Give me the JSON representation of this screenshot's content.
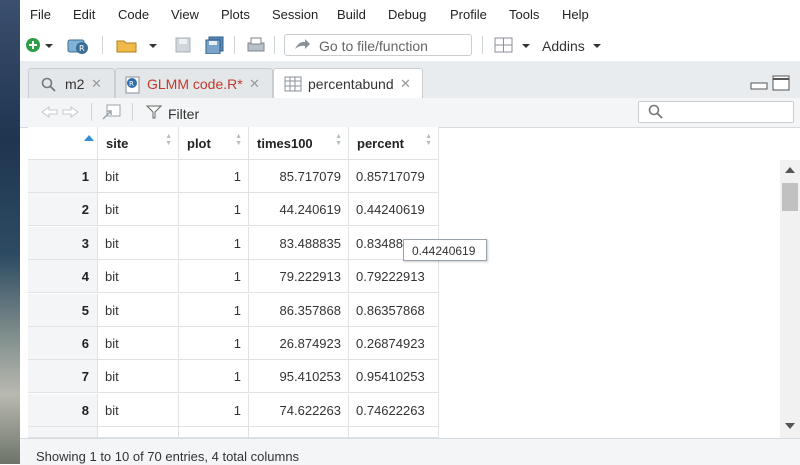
{
  "menu": [
    "File",
    "Edit",
    "Code",
    "View",
    "Plots",
    "Session",
    "Build",
    "Debug",
    "Profile",
    "Tools",
    "Help"
  ],
  "toolbar": {
    "goto_placeholder": "Go to file/function",
    "addins_label": "Addins"
  },
  "tabs": [
    {
      "label": "m2",
      "icon": "search-icon",
      "active": false
    },
    {
      "label": "GLMM code.R*",
      "icon": "r-script-icon",
      "active": false,
      "color": "#c0392b"
    },
    {
      "label": "percentabund",
      "icon": "table-icon",
      "active": true
    }
  ],
  "filter": {
    "label": "Filter"
  },
  "table": {
    "columns": [
      "site",
      "plot",
      "times100",
      "percent"
    ],
    "rows": [
      [
        "1",
        "bit",
        "1",
        "85.717079",
        "0.85717079"
      ],
      [
        "2",
        "bit",
        "1",
        "44.240619",
        "0.44240619"
      ],
      [
        "3",
        "bit",
        "1",
        "83.488835",
        "0.83488835"
      ],
      [
        "4",
        "bit",
        "1",
        "79.222913",
        "0.79222913"
      ],
      [
        "5",
        "bit",
        "1",
        "86.357868",
        "0.86357868"
      ],
      [
        "6",
        "bit",
        "1",
        "26.874923",
        "0.26874923"
      ],
      [
        "7",
        "bit",
        "1",
        "95.410253",
        "0.95410253"
      ],
      [
        "8",
        "bit",
        "1",
        "74.622263",
        "0.74622263"
      ]
    ]
  },
  "tooltip": "0.44240619",
  "status": "Showing 1 to 10 of 70 entries, 4 total columns"
}
